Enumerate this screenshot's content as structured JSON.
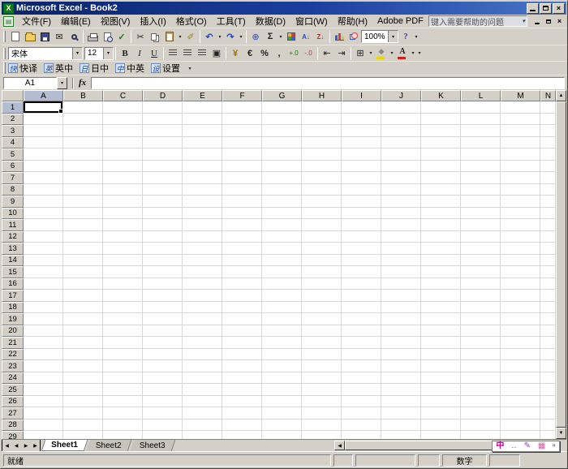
{
  "window": {
    "title": "Microsoft Excel - Book2",
    "app_icon_glyph": "X",
    "buttons": {
      "close": "×"
    }
  },
  "menu": {
    "items": [
      "文件(F)",
      "编辑(E)",
      "视图(V)",
      "插入(I)",
      "格式(O)",
      "工具(T)",
      "数据(D)",
      "窗口(W)",
      "帮助(H)",
      "Adobe PDF"
    ],
    "ask_placeholder": "键入需要帮助的问题",
    "window_buttons": {
      "close": "×"
    }
  },
  "icons": {
    "dropdown": "▾",
    "up": "▲",
    "down": "▼",
    "left": "◀",
    "right": "▶"
  },
  "toolbars": {
    "standard": {
      "mail": "✉",
      "spelling": "✓",
      "cut": "✂",
      "format_painter": "✐",
      "undo": "↶",
      "redo": "↷",
      "hyperlink": "⊕",
      "autosum": "Σ",
      "sort_asc": "A↓",
      "sort_desc": "Z↓",
      "zoom_value": "100%",
      "help": "?"
    },
    "formatting": {
      "font_name": "宋体",
      "font_size": "12",
      "bold": "B",
      "italic": "I",
      "underline": "U",
      "merge_center": "▣",
      "currency": "¥",
      "euro": "€",
      "percent": "%",
      "comma": ",",
      "increase_decimal": "+.0",
      "decrease_decimal": "-.0",
      "decrease_indent": "⇤",
      "increase_indent": "⇥",
      "borders": "⊞",
      "fill_color_glyph": "◆",
      "font_color_glyph": "A"
    },
    "kuaiyi": {
      "items": [
        {
          "badge": "快",
          "label": "快译"
        },
        {
          "badge": "英",
          "label": "英中"
        },
        {
          "badge": "日",
          "label": "日中"
        },
        {
          "badge": "中",
          "label": "中英"
        },
        {
          "badge": "设",
          "label": "设置"
        }
      ]
    }
  },
  "formula_bar": {
    "name_box": "A1",
    "fx_label": "fx"
  },
  "grid": {
    "columns": [
      "A",
      "B",
      "C",
      "D",
      "E",
      "F",
      "G",
      "H",
      "I",
      "J",
      "K",
      "L",
      "M",
      "N"
    ],
    "row_count": 29,
    "selected_cell": "A1",
    "selected_column": "A",
    "selected_row": 1
  },
  "sheet_tabs": {
    "tabs": [
      "Sheet1",
      "Sheet2",
      "Sheet3"
    ],
    "active": "Sheet1"
  },
  "status_bar": {
    "ready": "就绪",
    "num_lock": "数字"
  },
  "language_bar": {
    "ime": "中",
    "punct": "‥",
    "pen": "✎",
    "keyboard": "▦",
    "more": "▫"
  }
}
